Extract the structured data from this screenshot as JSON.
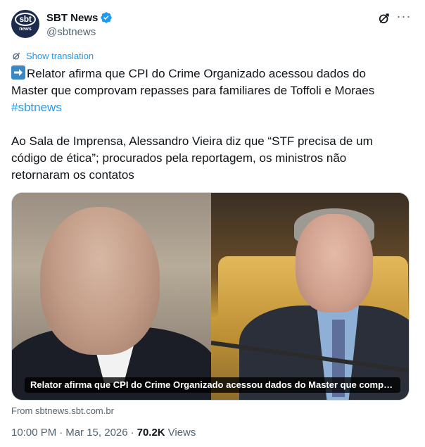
{
  "author": {
    "display_name": "SBT News",
    "handle": "@sbtnews",
    "avatar_text_top": "sbt",
    "avatar_text_bottom": "news",
    "verified": true
  },
  "translation": {
    "label": "Show translation"
  },
  "tweet": {
    "line1": "Relator afirma que CPI do Crime Organizado acessou dados do Master que comprovam repasses para familiares de Toffoli e Moraes",
    "hashtag": "#sbtnews",
    "line2": "Ao Sala de Imprensa, Alessandro Vieira diz que “STF precisa de um código de ética”; procurados pela reportagem, os ministros não retornaram os contatos"
  },
  "media": {
    "caption": "Relator afirma que CPI do Crime Organizado acessou dados do Master que comprovam repasses para familiares de Toffoli e Moraes"
  },
  "link": {
    "source": "From sbtnews.sbt.com.br"
  },
  "meta": {
    "time": "10:00 PM",
    "date": "Mar 15, 2026",
    "separator": "·",
    "views_count": "70.2K",
    "views_label": "Views"
  },
  "colors": {
    "accent": "#1d9bf0",
    "text": "#0f1419",
    "secondary": "#536471",
    "avatar_bg": "#1d2b4f"
  },
  "icons": [
    "verified-badge-icon",
    "grok-icon",
    "more-icon",
    "translate-icon",
    "right-arrow-emoji-icon"
  ]
}
